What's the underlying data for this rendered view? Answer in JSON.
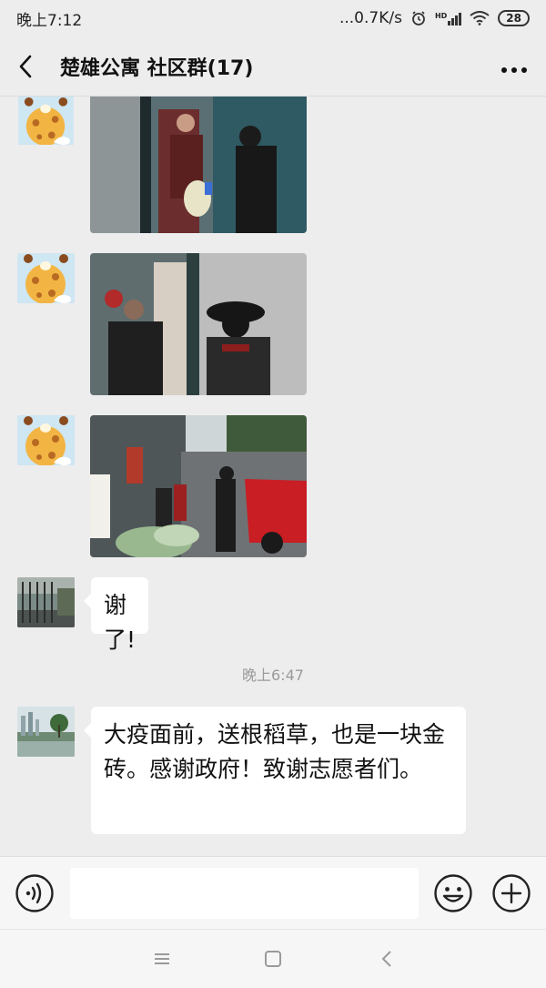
{
  "status_bar": {
    "time": "晚上7:12",
    "network_speed": "...0.7K/s",
    "hd_label": "HD",
    "battery": "28"
  },
  "header": {
    "title": "楚雄公寓 社区群(17)"
  },
  "messages": [
    {
      "type": "image",
      "avatar": "giraffe-avatar",
      "content": "photo-volunteer-delivering-bag-at-door"
    },
    {
      "type": "image",
      "avatar": "giraffe-avatar",
      "content": "photo-volunteer-at-apartment-door"
    },
    {
      "type": "image",
      "avatar": "giraffe-avatar",
      "content": "photo-vegetables-outside-building"
    },
    {
      "type": "text",
      "avatar": "fence-photo-avatar",
      "text": "谢了!"
    },
    {
      "type": "text",
      "avatar": "lake-photo-avatar",
      "text": "大疫面前，送根稻草，也是一块金砖。感谢政府！致谢志愿者们。"
    }
  ],
  "timestamp": "晚上6:47",
  "input_bar": {
    "voice_icon": "voice-icon",
    "emoji_icon": "emoji-icon",
    "plus_icon": "plus-icon",
    "value": ""
  },
  "colors": {
    "background": "#ededed",
    "bubble": "#ffffff",
    "timestamp": "#9a9a9a"
  }
}
